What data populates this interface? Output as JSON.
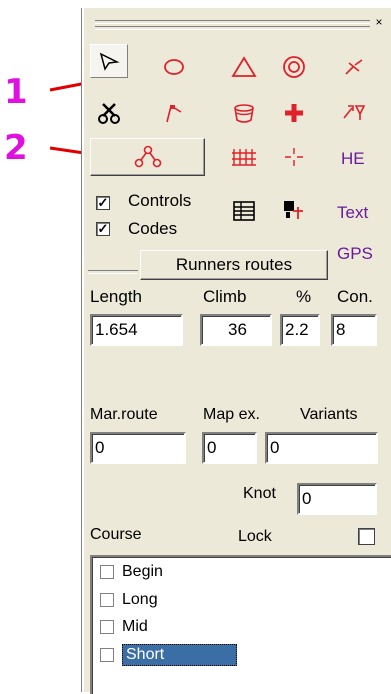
{
  "annotations": {
    "one": "1",
    "two": "2"
  },
  "toolbar": {
    "close_glyph": "×"
  },
  "tools": {
    "he": "HE",
    "text": "Text",
    "gps": "GPS"
  },
  "checkboxes": {
    "controls": {
      "label": "Controls",
      "checked": true
    },
    "codes": {
      "label": "Codes",
      "checked": true
    }
  },
  "runners_routes_label": "Runners routes",
  "stats": {
    "length_label": "Length",
    "length_value": "1.654",
    "climb_label": "Climb",
    "climb_value": "36",
    "percent_label": "%",
    "percent_value": "2.2",
    "con_label": "Con.",
    "con_value": "8"
  },
  "extra": {
    "marroute_label": "Mar.route",
    "marroute_value": "0",
    "mapex_label": "Map ex.",
    "mapex_value": "0",
    "variants_label": "Variants",
    "variants_value": "0",
    "knot_label": "Knot",
    "knot_value": "0"
  },
  "course": {
    "label": "Course",
    "lock_label": "Lock",
    "items": [
      {
        "label": "Begin",
        "checked": false,
        "selected": false
      },
      {
        "label": "Long",
        "checked": false,
        "selected": false
      },
      {
        "label": "Mid",
        "checked": false,
        "selected": false
      },
      {
        "label": "Short",
        "checked": false,
        "selected": true
      }
    ]
  },
  "colors": {
    "accent_red": "#e0202a",
    "purple": "#6a1b9a",
    "annotation": "#e010e0",
    "selection": "#3a6ea5"
  }
}
